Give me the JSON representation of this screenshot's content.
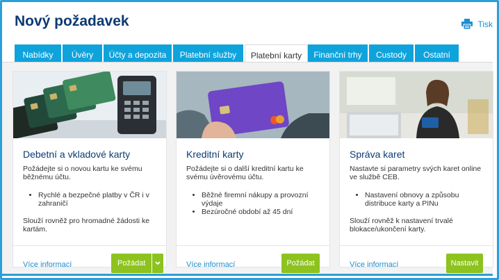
{
  "page": {
    "title": "Nový požadavek",
    "print_label": "Tisk"
  },
  "tabs": [
    {
      "label": "Nabídky",
      "active": false
    },
    {
      "label": "Úvěry",
      "active": false
    },
    {
      "label": "Účty a depozita",
      "active": false
    },
    {
      "label": "Platební služby",
      "active": false
    },
    {
      "label": "Platební karty",
      "active": true
    },
    {
      "label": "Finanční trhy",
      "active": false
    },
    {
      "label": "Custody",
      "active": false
    },
    {
      "label": "Ostatní",
      "active": false
    }
  ],
  "cards": [
    {
      "title": "Debetní a vkladové karty",
      "description": "Požádejte si o novou kartu ke svému běžnému účtu.",
      "bullets": [
        "Rychlé a bezpečné platby v ČR i v zahraničí"
      ],
      "note": "Slouží rovněž pro hromadné žádosti ke kartám.",
      "more_label": "Více informací",
      "button_label": "Požádat",
      "has_dropdown": true,
      "image": "payment-cards-and-terminal"
    },
    {
      "title": "Kreditní karty",
      "description": "Požádejte si o další kreditní kartu ke svému úvěrovému účtu.",
      "bullets": [
        "Běžné firemní nákupy a provozní výdaje",
        "Bezúročné období až 45 dní"
      ],
      "note": "",
      "more_label": "Více informací",
      "button_label": "Požádat",
      "has_dropdown": false,
      "image": "hand-holding-credit-card"
    },
    {
      "title": "Správa karet",
      "description": "Nastavte si parametry svých karet online ve službě CEB.",
      "bullets": [
        "Nastavení obnovy a způsobu distribuce karty a PINu"
      ],
      "note": "Slouží rovněž k nastavení trvalé blokace/ukončení karty.",
      "more_label": "Více informací",
      "button_label": "Nastavit",
      "has_dropdown": false,
      "image": "woman-with-card-and-laptop"
    }
  ],
  "colors": {
    "accent": "#0fa3dc",
    "title": "#0b3a73",
    "button": "#8dc21f",
    "link": "#1b8fd0",
    "frame": "#2a9fd8"
  },
  "icons": {
    "print": "printer-icon",
    "dropdown": "chevron-down-icon"
  }
}
